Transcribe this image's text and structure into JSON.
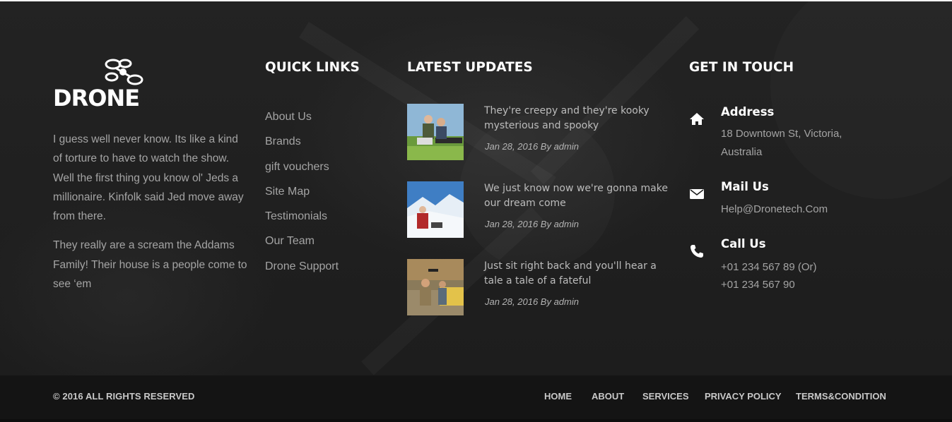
{
  "brand": {
    "name": "DRONE"
  },
  "about": {
    "paragraphs": [
      "I guess well never know. Its like a kind of torture to have  to watch the show. Well the first thing you know ol' Jeds a millionaire. Kinfolk said Jed move away from there.",
      "They really are a scream the Addams Family! Their house is a people come to see ‘em"
    ]
  },
  "quick_links": {
    "title": "QUICK LINKS",
    "items": [
      "About Us",
      "Brands",
      "gift vouchers",
      "Site Map",
      "Testimonials",
      "Our Team",
      "Drone Support"
    ]
  },
  "latest_updates": {
    "title": "LATEST UPDATES",
    "posts": [
      {
        "title": "They're creepy and they're kooky mysterious and spooky",
        "meta": "Jan 28, 2016  By admin"
      },
      {
        "title": "We just know now we're gonna make our dream come",
        "meta": "Jan 28, 2016  By admin"
      },
      {
        "title": "Just sit right back and you'll hear a tale a tale of a fateful",
        "meta": "Jan 28, 2016  By admin"
      }
    ]
  },
  "get_in_touch": {
    "title": "GET IN TOUCH",
    "address": {
      "title": "Address",
      "lines": [
        "18 Downtown St, Victoria,",
        "Australia"
      ]
    },
    "mail": {
      "title": "Mail Us",
      "lines": [
        "Help@Dronetech.Com"
      ]
    },
    "call": {
      "title": "Call Us",
      "lines": [
        "+01 234 567 89 (Or)",
        "+01 234 567 90"
      ]
    }
  },
  "bottom_bar": {
    "copyright": "© 2016 ALL RIGHTS RESERVED",
    "nav": [
      "HOME",
      "ABOUT",
      "SERVICES",
      "PRIVACY POLICY",
      "TERMS&CONDITION"
    ]
  },
  "icons": {
    "logo": "drone-logo-icon",
    "address": "home-icon",
    "mail": "envelope-icon",
    "call": "phone-icon"
  },
  "colors": {
    "background": "#1f1f1f",
    "bottom_bar": "#141414",
    "heading": "#ffffff",
    "body_text": "#a4a4a4"
  }
}
